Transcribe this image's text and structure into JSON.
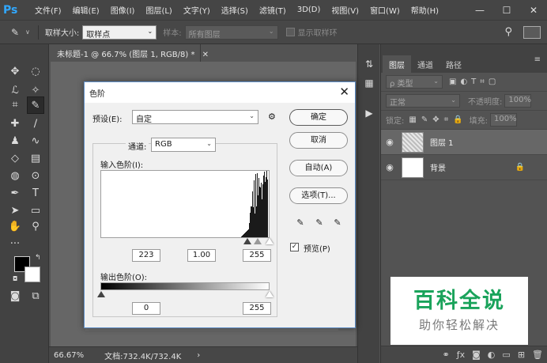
{
  "app": {
    "logo": "Ps",
    "menu": [
      "文件(F)",
      "编辑(E)",
      "图像(I)",
      "图层(L)",
      "文字(Y)",
      "选择(S)",
      "滤镜(T)",
      "3D(D)",
      "视图(V)",
      "窗口(W)",
      "帮助(H)"
    ],
    "window_controls": [
      "—",
      "☐",
      "✕"
    ]
  },
  "options_bar": {
    "sample_size_label": "取样大小:",
    "sample_size_value": "取样点",
    "sample_label": "样本:",
    "sample_value": "所有图层",
    "show_ring_label": "显示取样环"
  },
  "document": {
    "tab_title": "未标题-1 @ 66.7% (图层 1, RGB/8) *",
    "zoom": "66.67%",
    "doc_info": "文档:732.4K/732.4K"
  },
  "layers_panel": {
    "tabs": [
      "图层",
      "通道",
      "路径"
    ],
    "filter_kind": "ρ 类型",
    "blend_mode": "正常",
    "opacity_label": "不透明度:",
    "opacity_value": "100%",
    "lock_label": "锁定:",
    "fill_label": "填充:",
    "fill_value": "100%",
    "layers": [
      {
        "name": "图层 1",
        "selected": true
      },
      {
        "name": "背景",
        "selected": false
      }
    ]
  },
  "levels_dialog": {
    "title": "色阶",
    "preset_label": "预设(E):",
    "preset_value": "自定",
    "channel_label": "通道:",
    "channel_value": "RGB",
    "input_label": "输入色阶(I):",
    "input_black": "223",
    "input_gamma": "1.00",
    "input_white": "255",
    "output_label": "输出色阶(O):",
    "output_black": "0",
    "output_white": "255",
    "buttons": {
      "ok": "确定",
      "cancel": "取消",
      "auto": "自动(A)",
      "options": "选项(T)..."
    },
    "preview_label": "预览(P)",
    "preview_checked": true
  },
  "watermark": {
    "main": "百科全说",
    "sub": "助你轻松解决"
  },
  "colors": {
    "ps_blue": "#31a8ff",
    "watermark_green": "#1aa35b",
    "dialog_border": "#5f8fc8"
  }
}
